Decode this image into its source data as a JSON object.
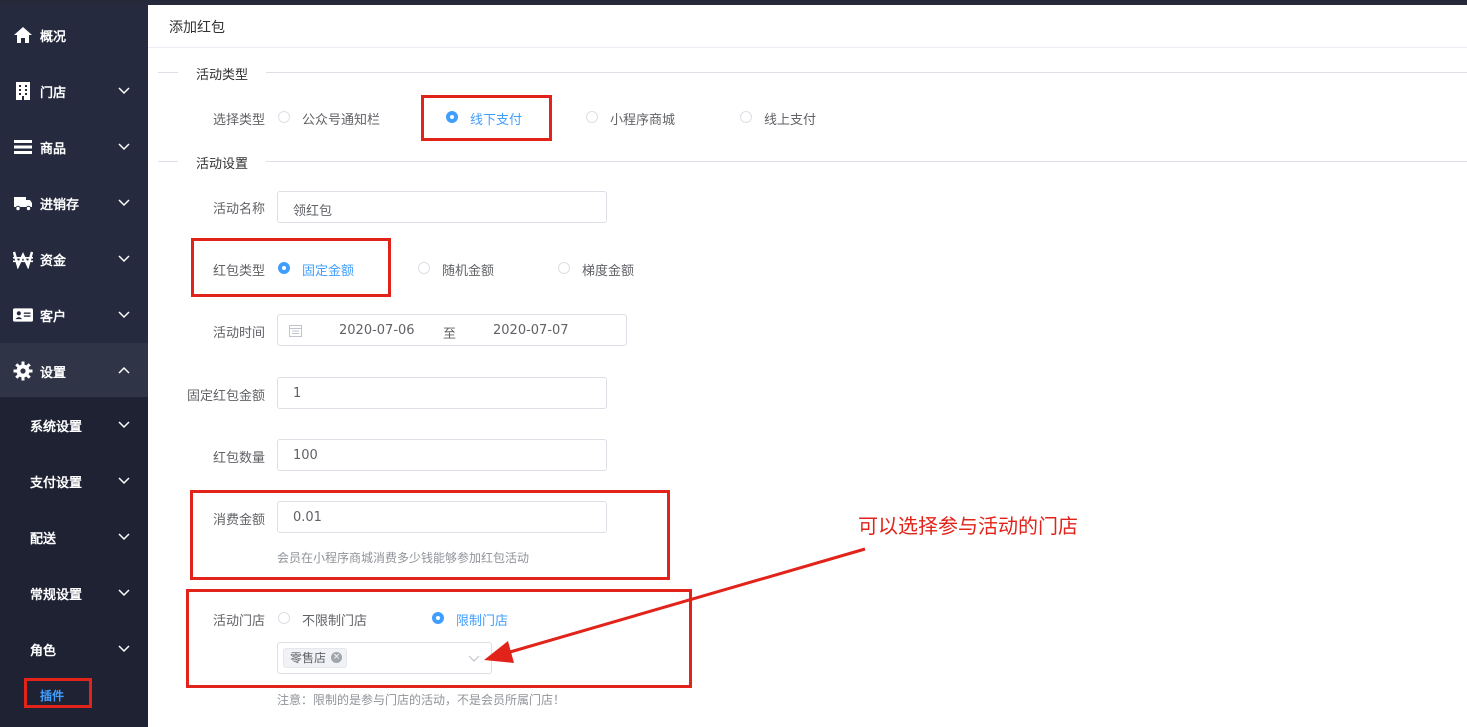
{
  "sidebar": {
    "items": [
      {
        "label": "概况",
        "icon": "home-icon"
      },
      {
        "label": "门店",
        "icon": "building-icon"
      },
      {
        "label": "商品",
        "icon": "list-icon"
      },
      {
        "label": "进销存",
        "icon": "truck-icon"
      },
      {
        "label": "资金",
        "icon": "won-icon"
      },
      {
        "label": "客户",
        "icon": "id-card-icon"
      },
      {
        "label": "设置",
        "icon": "gear-icon"
      }
    ],
    "sub_items": [
      {
        "label": "系统设置"
      },
      {
        "label": "支付设置"
      },
      {
        "label": "配送"
      },
      {
        "label": "常规设置"
      },
      {
        "label": "角色"
      }
    ],
    "active_plugin": "插件"
  },
  "header": {
    "title": "添加红包"
  },
  "section_type": {
    "title": "活动类型",
    "label": "选择类型",
    "options": [
      "公众号通知栏",
      "线下支付",
      "小程序商城",
      "线上支付"
    ],
    "selected": "线下支付"
  },
  "section_settings": {
    "title": "活动设置",
    "name_label": "活动名称",
    "name_value": "领红包",
    "redpack_type_label": "红包类型",
    "redpack_type_options": [
      "固定金额",
      "随机金额",
      "梯度金额"
    ],
    "redpack_type_selected": "固定金额",
    "time_label": "活动时间",
    "start_date": "2020-07-06",
    "range_separator": "至",
    "end_date": "2020-07-07",
    "fixed_amount_label": "固定红包金额",
    "fixed_amount_value": "1",
    "count_label": "红包数量",
    "count_value": "100",
    "spend_label": "消费金额",
    "spend_value": "0.01",
    "spend_hint": "会员在小程序商城消费多少钱能够参加红包活动",
    "store_label": "活动门店",
    "store_options": [
      "不限制门店",
      "限制门店"
    ],
    "store_selected": "限制门店",
    "store_tag": "零售店",
    "store_note": "注意：限制的是参与门店的活动，不是会员所属门店！"
  },
  "annotation": {
    "text": "可以选择参与活动的门店"
  },
  "colors": {
    "accent": "#409eff",
    "sidebar": "#262a3e",
    "highlight": "#e2231a"
  }
}
